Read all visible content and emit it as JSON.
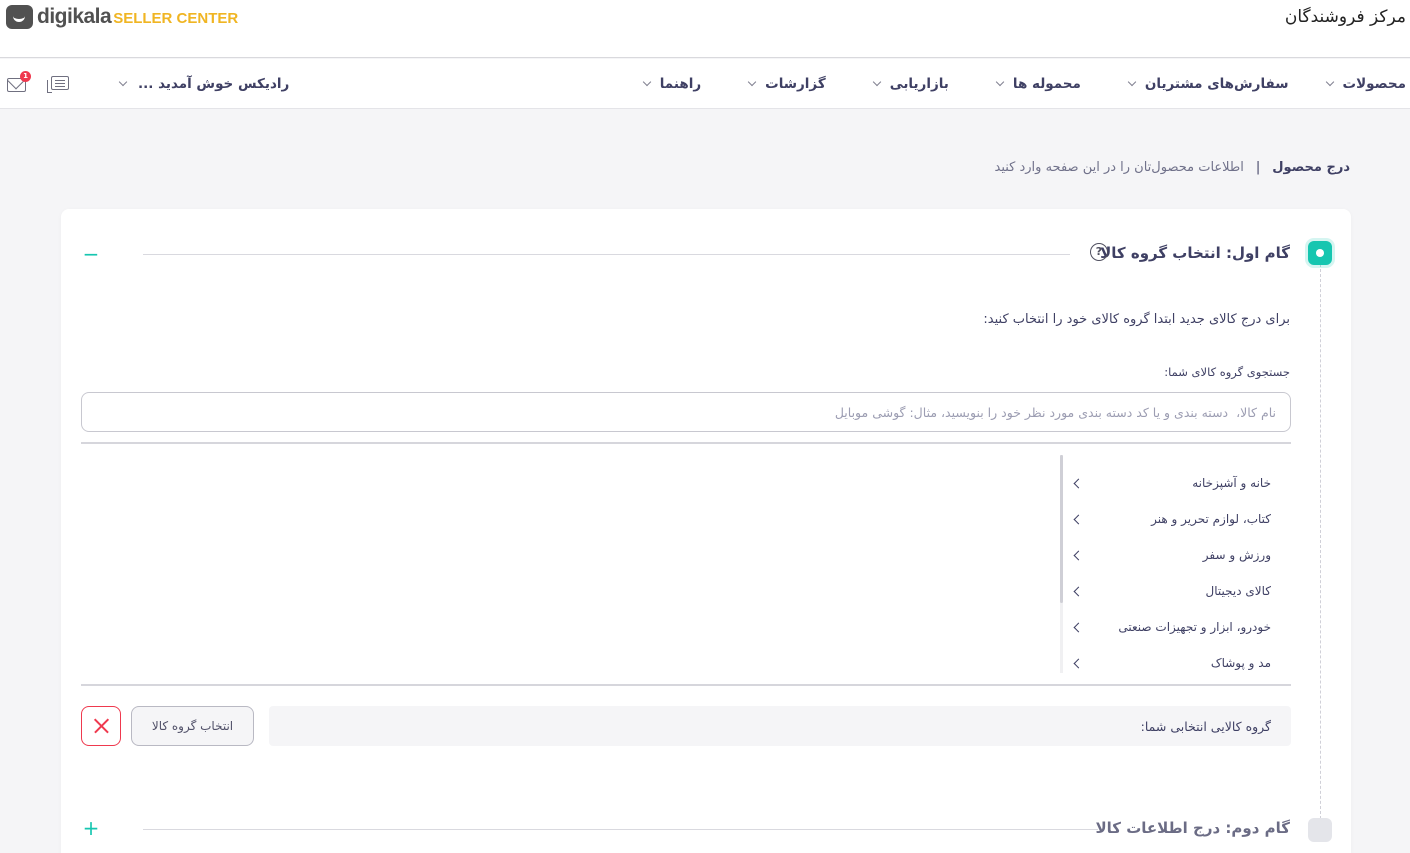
{
  "header": {
    "logo_word": "digikala",
    "logo_sub": "SELLER CENTER",
    "site_title": "مرکز فروشندگان"
  },
  "nav": {
    "items": [
      {
        "label": "محصولات"
      },
      {
        "label": "سفارش‌های مشتریان"
      },
      {
        "label": "محموله ها"
      },
      {
        "label": "بازاریابی"
      },
      {
        "label": "گزارشات"
      },
      {
        "label": "راهنما"
      }
    ],
    "user_greeting": "رادیکس خوش آمدید ...",
    "notification_count": "1",
    "icons": [
      "mail-icon",
      "messages-icon"
    ]
  },
  "breadcrumb": {
    "title": "درج محصول",
    "separator": "|",
    "description": "اطلاعات محصول‌تان را در این صفحه وارد کنید"
  },
  "step1": {
    "title": "گام اول: انتخاب گروه کالا",
    "help_glyph": "?",
    "toggle": "−",
    "intro": "برای درج کالای جدید ابتدا گروه کالای خود را انتخاب کنید:",
    "search": {
      "label": "جستجوی گروه کالای شما:",
      "placeholder": "نام کالا،  دسته بندی و یا کد دسته بندی مورد نظر خود را بنویسید، مثال: گوشی موبایل",
      "value": ""
    },
    "categories": [
      {
        "label": "خانه و آشپزخانه"
      },
      {
        "label": "کتاب، لوازم تحریر و هنر"
      },
      {
        "label": "ورزش و سفر"
      },
      {
        "label": "کالای دیجیتال"
      },
      {
        "label": "خودرو، ابزار و تجهیزات صنعتی"
      },
      {
        "label": "مد و پوشاک"
      }
    ],
    "selected_label": "گروه کالایی انتخابی شما:",
    "select_button": "انتخاب گروه کالا"
  },
  "step2": {
    "title": "گام دوم: درج اطلاعات کالا",
    "toggle": "+"
  },
  "colors": {
    "accent": "#16c6b0",
    "danger": "#ef394e",
    "logo_sub": "#f0b523",
    "text": "#3f4064"
  }
}
